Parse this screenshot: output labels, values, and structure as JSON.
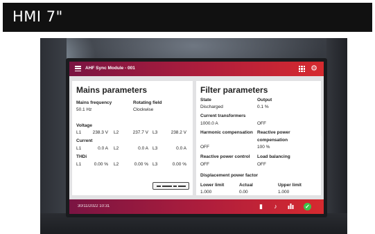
{
  "banner": {
    "title": "HMI 7\""
  },
  "app": {
    "title": "AHF Sync Module - 001",
    "timestamp": "30/11/2022 10:31"
  },
  "mains": {
    "title": "Mains parameters",
    "frequency_label": "Mains frequency",
    "frequency_value": "50.1 Hz",
    "rotating_label": "Rotating field",
    "rotating_value": "Clockwise",
    "voltage_label": "Voltage",
    "voltage": [
      {
        "phase": "L1",
        "value": "238.3 V"
      },
      {
        "phase": "L2",
        "value": "237.7 V"
      },
      {
        "phase": "L3",
        "value": "238.2 V"
      }
    ],
    "current_label": "Current",
    "current": [
      {
        "phase": "L1",
        "value": "0.0 A"
      },
      {
        "phase": "L2",
        "value": "0.0 A"
      },
      {
        "phase": "L3",
        "value": "0.0 A"
      }
    ],
    "thdi_label": "THDi",
    "thdi": [
      {
        "phase": "L1",
        "value": "0.00 %"
      },
      {
        "phase": "L2",
        "value": "0.00 %"
      },
      {
        "phase": "L3",
        "value": "0.00 %"
      }
    ]
  },
  "filter": {
    "title": "Filter parameters",
    "state_label": "State",
    "state_value": "Discharged",
    "output_label": "Output",
    "output_value": "0.1 %",
    "ct_label": "Current transformers",
    "ct_value": "1000.0 A",
    "ct_status": "OFF",
    "harmonic_label": "Harmonic compensation",
    "harmonic_value": "OFF",
    "reactive_comp_label_1": "Reactive power",
    "reactive_comp_label_2": "compensation",
    "reactive_comp_value": "100 %",
    "reactive_ctrl_label": "Reactive power control",
    "reactive_ctrl_value": "OFF",
    "load_bal_label": "Load balancing",
    "load_bal_value": "OFF",
    "dpf_label": "Displacement power factor",
    "lower_label": "Lower limit",
    "lower_value": "1.000",
    "actual_label": "Actual",
    "actual_value": "0.00",
    "upper_label": "Upper limit",
    "upper_value": "1.000"
  },
  "colors": {
    "bar_start": "#7a1442",
    "bar_end": "#d62a2f",
    "ok_green": "#3cc34a"
  },
  "icons": [
    "menu-icon",
    "grid-icon",
    "gear-icon",
    "document-icon",
    "bell-icon",
    "bar-chart-icon",
    "check-circle-icon",
    "device-icon",
    "chevron-right-icon"
  ]
}
